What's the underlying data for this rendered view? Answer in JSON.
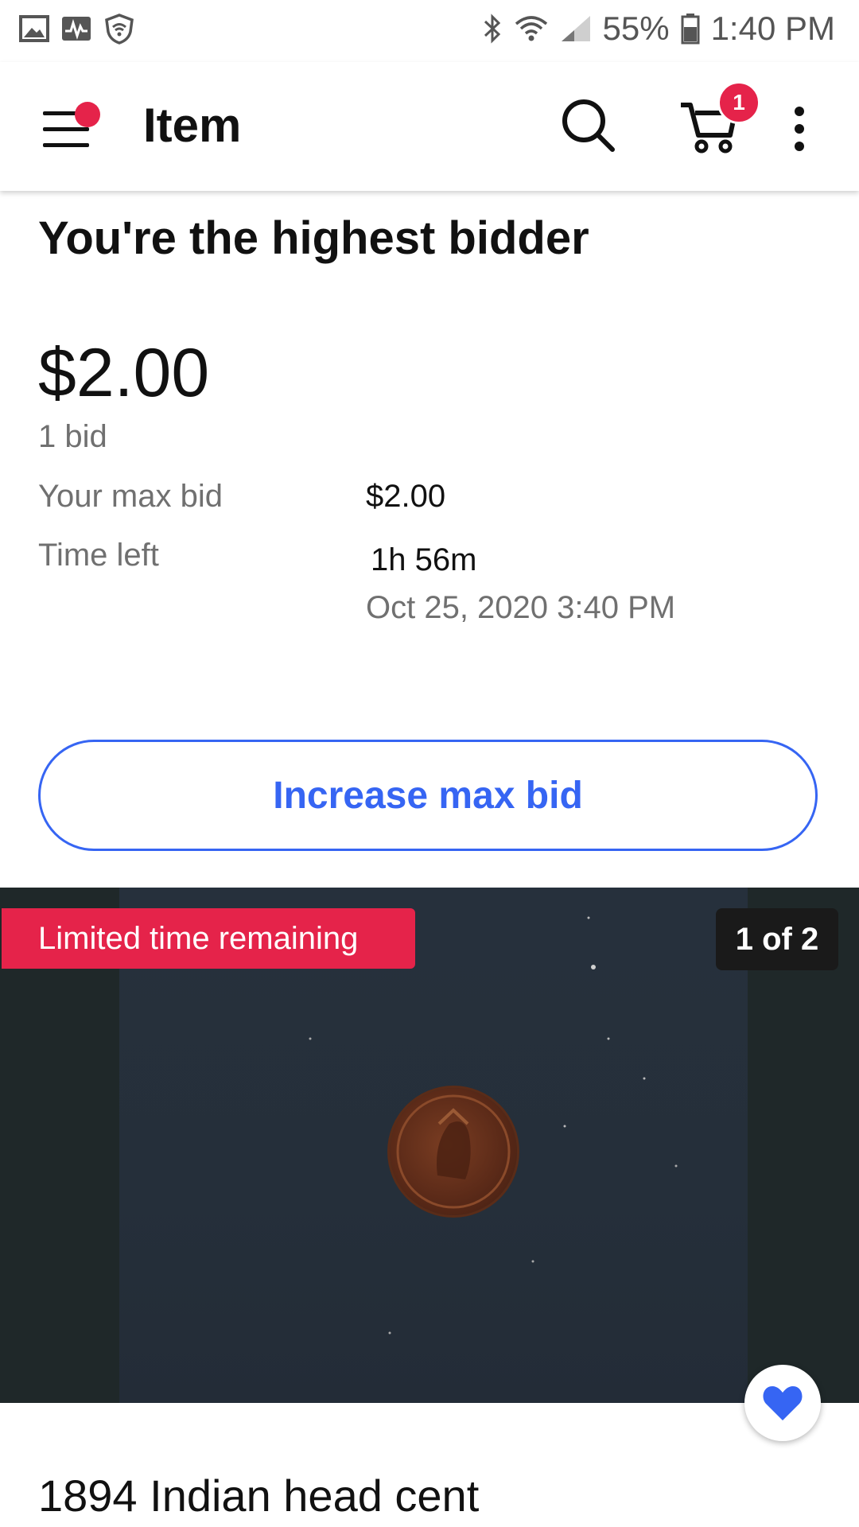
{
  "status_bar": {
    "battery": "55%",
    "time": "1:40 PM",
    "left_icons": [
      "image-icon",
      "activity-icon",
      "shield-wifi-icon"
    ],
    "right_icons": [
      "bluetooth-icon",
      "wifi-icon",
      "signal-icon",
      "battery-icon"
    ]
  },
  "app_bar": {
    "title": "Item",
    "cart_count": "1",
    "icons": [
      "menu-icon",
      "search-icon",
      "cart-icon",
      "more-vert-icon"
    ]
  },
  "bid_status": {
    "headline": "You're the highest bidder",
    "price": "$2.00",
    "bid_count": "1 bid",
    "max_bid_label": "Your max bid",
    "max_bid_value": "$2.00",
    "time_left_label": "Time left",
    "time_left_value": "1h 56m",
    "end_date": "Oct 25, 2020 3:40 PM",
    "increase_button": "Increase max bid"
  },
  "gallery": {
    "badge": "Limited time remaining",
    "counter": "1 of 2"
  },
  "item": {
    "title": "1894 Indian head cent"
  },
  "colors": {
    "accent": "#3665f3",
    "badge_red": "#e5234a"
  }
}
